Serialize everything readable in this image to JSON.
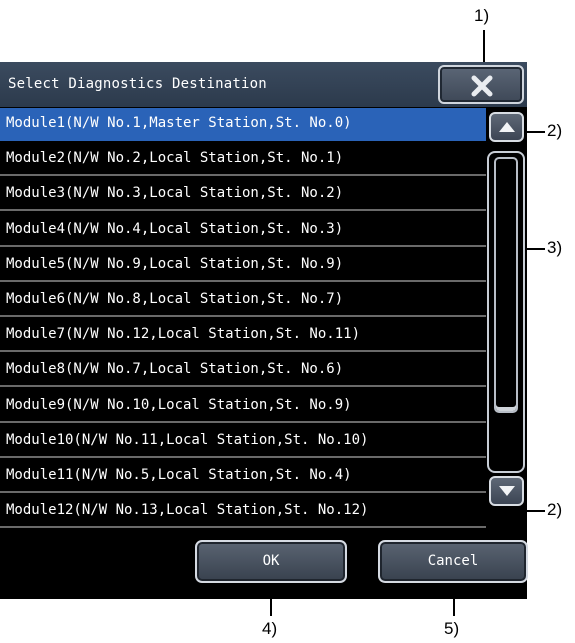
{
  "callouts": {
    "c1": "1)",
    "c2a": "2)",
    "c2b": "2)",
    "c3": "3)",
    "c4": "4)",
    "c5": "5)"
  },
  "dialog": {
    "title": "Select Diagnostics Destination",
    "close_icon": "close-x-icon",
    "modules": [
      "Module1(N/W No.1,Master Station,St. No.0)",
      "Module2(N/W No.2,Local Station,St. No.1)",
      "Module3(N/W No.3,Local Station,St. No.2)",
      "Module4(N/W No.4,Local Station,St. No.3)",
      "Module5(N/W No.9,Local Station,St. No.9)",
      "Module6(N/W No.8,Local Station,St. No.7)",
      "Module7(N/W No.12,Local Station,St. No.11)",
      "Module8(N/W No.7,Local Station,St. No.6)",
      "Module9(N/W No.10,Local Station,St. No.9)",
      "Module10(N/W No.11,Local Station,St. No.10)",
      "Module11(N/W No.5,Local Station,St. No.4)",
      "Module12(N/W No.13,Local Station,St. No.12)"
    ],
    "selected_index": 0,
    "ok_label": "OK",
    "cancel_label": "Cancel"
  },
  "colors": {
    "selected_row": "#2a63b8",
    "titlebar": "#33435a",
    "background": "#000000"
  }
}
